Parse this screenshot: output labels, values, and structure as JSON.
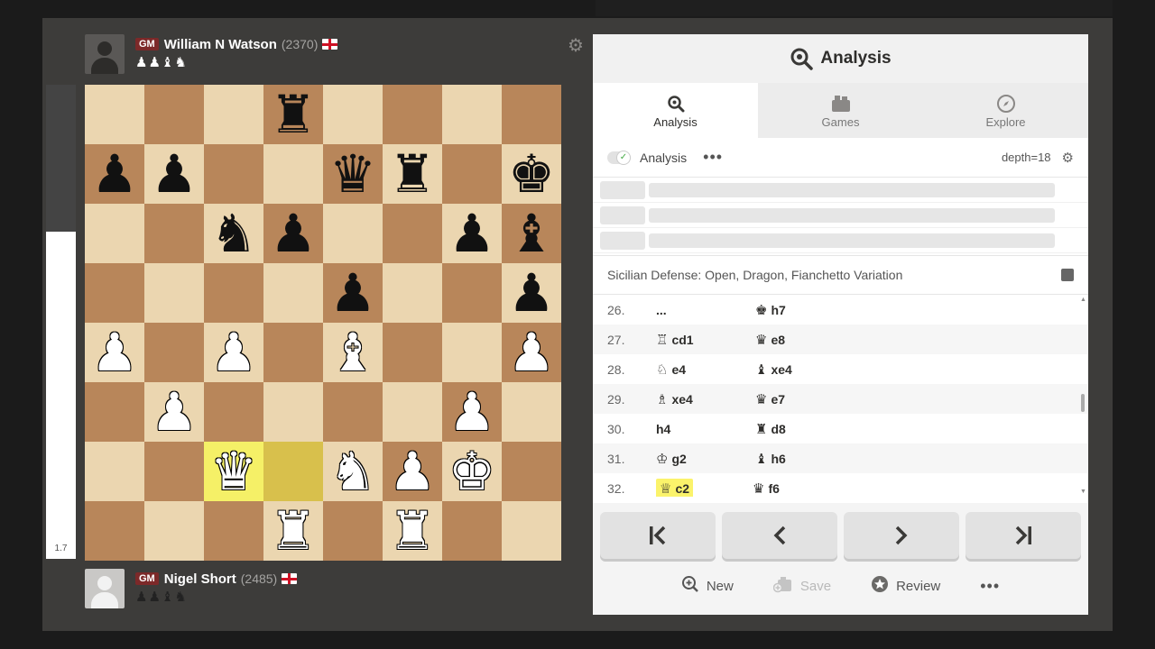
{
  "players": {
    "top": {
      "title": "GM",
      "name": "William N Watson",
      "rating": "(2370)",
      "captured": "♟♟♝♞"
    },
    "bottom": {
      "title": "GM",
      "name": "Nigel Short",
      "rating": "(2485)",
      "captured": "♟♟♝♞"
    }
  },
  "eval": {
    "score": "1.7",
    "white_fraction": 0.69
  },
  "board": {
    "ranks": [
      [
        "",
        "",
        "",
        "b:♜",
        "",
        "",
        "",
        ""
      ],
      [
        "b:♟",
        "b:♟",
        "",
        "",
        "b:♛",
        "b:♜",
        "",
        "b:♚"
      ],
      [
        "",
        "",
        "b:♞",
        "b:♟",
        "",
        "",
        "b:♟",
        "b:♝"
      ],
      [
        "",
        "",
        "",
        "",
        "b:♟",
        "",
        "",
        "b:♟"
      ],
      [
        "w:♟",
        "",
        "w:♟",
        "",
        "w:♝",
        "",
        "",
        "w:♟"
      ],
      [
        "",
        "w:♟",
        "",
        "",
        "",
        "",
        "w:♟",
        ""
      ],
      [
        "",
        "",
        "w:♛",
        "",
        "w:♞",
        "w:♟",
        "w:♚",
        ""
      ],
      [
        "",
        "",
        "",
        "w:♜",
        "",
        "w:♜",
        "",
        ""
      ]
    ],
    "highlight": [
      "c2",
      "d2"
    ]
  },
  "panel": {
    "title": "Analysis",
    "tabs": [
      {
        "label": "Analysis",
        "icon": "magnifier-icon",
        "active": true
      },
      {
        "label": "Games",
        "icon": "games-icon",
        "active": false
      },
      {
        "label": "Explore",
        "icon": "compass-icon",
        "active": false
      }
    ],
    "engine": {
      "label": "Analysis",
      "depth": "depth=18"
    },
    "opening": "Sicilian Defense: Open, Dragon, Fianchetto Variation",
    "moves": [
      {
        "no": "26.",
        "white": "...",
        "wfig": "",
        "black": "h7",
        "bfig": "♚"
      },
      {
        "no": "27.",
        "white": "cd1",
        "wfig": "♖",
        "black": "e8",
        "bfig": "♛"
      },
      {
        "no": "28.",
        "white": "e4",
        "wfig": "♘",
        "black": "xe4",
        "bfig": "♝"
      },
      {
        "no": "29.",
        "white": "xe4",
        "wfig": "♗",
        "black": "e7",
        "bfig": "♛"
      },
      {
        "no": "30.",
        "white": "h4",
        "wfig": "",
        "black": "d8",
        "bfig": "♜"
      },
      {
        "no": "31.",
        "white": "g2",
        "wfig": "♔",
        "black": "h6",
        "bfig": "♝"
      },
      {
        "no": "32.",
        "white": "c2",
        "wfig": "♕",
        "black": "f6",
        "bfig": "♛",
        "current": true
      }
    ],
    "actions": {
      "new": "New",
      "save": "Save",
      "review": "Review"
    }
  }
}
